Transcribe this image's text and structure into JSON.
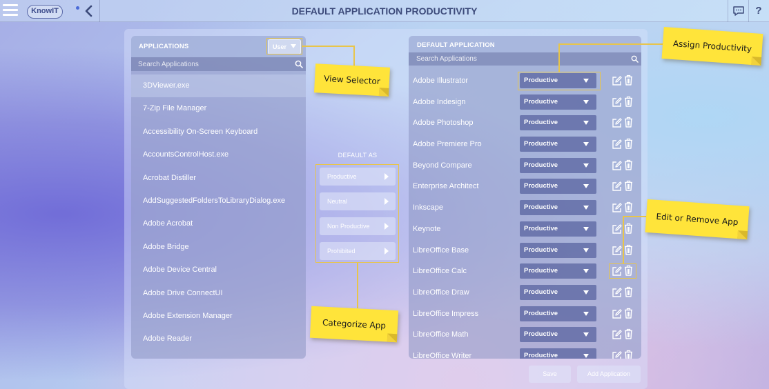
{
  "header": {
    "logo_text": "KnowIT",
    "title": "DEFAULT APPLICATION PRODUCTIVITY",
    "help_label": "?"
  },
  "applications": {
    "title": "APPLICATIONS",
    "view_selector": "User",
    "search_placeholder": "Search Applications",
    "items": [
      "3DViewer.exe",
      "7-Zip File Manager",
      "Accessibility On-Screen Keyboard",
      "AccountsControlHost.exe",
      "Acrobat Distiller",
      "AddSuggestedFoldersToLibraryDialog.exe",
      "Adobe Acrobat",
      "Adobe Bridge",
      "Adobe Device Central",
      "Adobe Drive ConnectUI",
      "Adobe Extension Manager",
      "Adobe Reader"
    ],
    "selected_index": 0
  },
  "default_as": {
    "label": "DEFAULT AS",
    "buttons": [
      "Productive",
      "Neutral",
      "Non Productive",
      "Prohibited"
    ]
  },
  "default_application": {
    "title": "DEFAULT APPLICATION",
    "search_placeholder": "Search Applications",
    "rows": [
      {
        "name": "Adobe Illustrator",
        "productivity": "Productive"
      },
      {
        "name": "Adobe Indesign",
        "productivity": "Productive"
      },
      {
        "name": "Adobe Photoshop",
        "productivity": "Productive"
      },
      {
        "name": "Adobe Premiere Pro",
        "productivity": "Productive"
      },
      {
        "name": "Beyond Compare",
        "productivity": "Productive"
      },
      {
        "name": "Enterprise Architect",
        "productivity": "Productive"
      },
      {
        "name": "Inkscape",
        "productivity": "Productive"
      },
      {
        "name": "Keynote",
        "productivity": "Productive"
      },
      {
        "name": "LibreOffice Base",
        "productivity": "Productive"
      },
      {
        "name": "LibreOffice Calc",
        "productivity": "Productive"
      },
      {
        "name": "LibreOffice Draw",
        "productivity": "Productive"
      },
      {
        "name": "LibreOffice Impress",
        "productivity": "Productive"
      },
      {
        "name": "LibreOffice Math",
        "productivity": "Productive"
      },
      {
        "name": "LibreOffice Writer",
        "productivity": "Productive"
      }
    ]
  },
  "footer": {
    "save_label": "Save",
    "add_label": "Add Application"
  },
  "annotations": {
    "view_selector": "View Selector",
    "assign_productivity": "Assign Productivity",
    "categorize_app": "Categorize App",
    "edit_remove": "Edit or Remove App"
  },
  "colors": {
    "note_yellow": "#ffe43a",
    "highlight": "#e8c54a",
    "title_text": "#3c4a7a"
  }
}
